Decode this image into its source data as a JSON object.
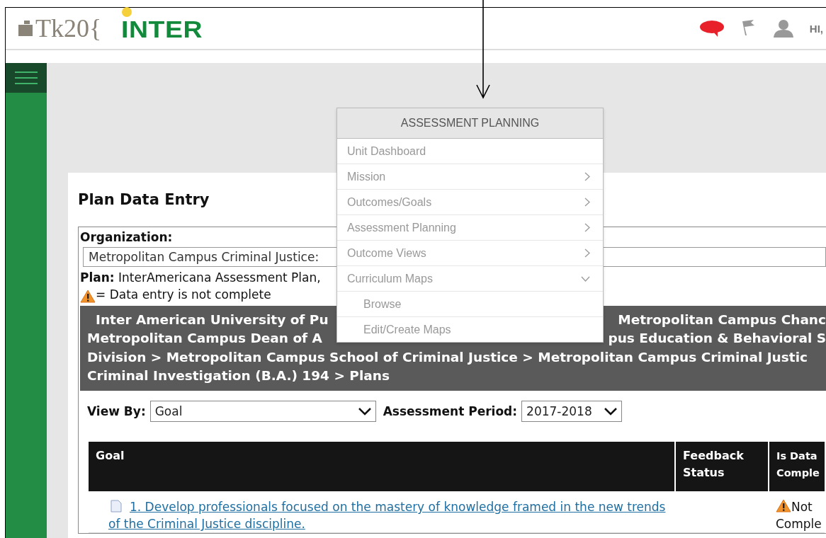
{
  "header": {
    "logo_text": "Tk20{",
    "brand": "INTER",
    "greeting": "HI,"
  },
  "page": {
    "title": "Plan Data Entry",
    "organization": {
      "label": "Organization:",
      "value": "Metropolitan Campus Criminal Justice:"
    },
    "plan": {
      "label": "Plan:",
      "value": "InterAmericana Assessment Plan,"
    },
    "legend": "= Data entry is not complete",
    "breadcrumb": [
      {
        "left": "Inter American University of Pu",
        "right": "Metropolitan Campus Chanc"
      },
      {
        "left": "Metropolitan Campus Dean of A",
        "right": "pus Education & Behavioral S"
      },
      {
        "left": "Division > Metropolitan Campus School of Criminal Justice > Metropolitan Campus Criminal Justic"
      },
      {
        "left": "Criminal Investigation (B.A.) 194 > Plans"
      }
    ],
    "view_by": {
      "label": "View By:",
      "value": "Goal"
    },
    "period": {
      "label": "Assessment Period:",
      "value": "2017-2018"
    },
    "table": {
      "columns": [
        "Goal",
        "Feedback Status",
        "Is Data Comple"
      ],
      "rows": [
        {
          "goal": "1. Develop professionals focused on the mastery of knowledge framed in the new trends of the Criminal Justice discipline.",
          "feedback": "",
          "complete": false,
          "status": "Not Comple"
        }
      ]
    }
  },
  "menu": {
    "title": "ASSESSMENT PLANNING",
    "items": [
      {
        "label": "Unit Dashboard",
        "kind": "link"
      },
      {
        "label": "Mission",
        "kind": "submenu"
      },
      {
        "label": "Outcomes/Goals",
        "kind": "submenu"
      },
      {
        "label": "Assessment Planning",
        "kind": "submenu"
      },
      {
        "label": "Outcome Views",
        "kind": "submenu"
      },
      {
        "label": "Curriculum Maps",
        "kind": "group",
        "expanded": true,
        "children": [
          {
            "label": "Browse"
          },
          {
            "label": "Edit/Create Maps"
          }
        ]
      }
    ]
  }
}
